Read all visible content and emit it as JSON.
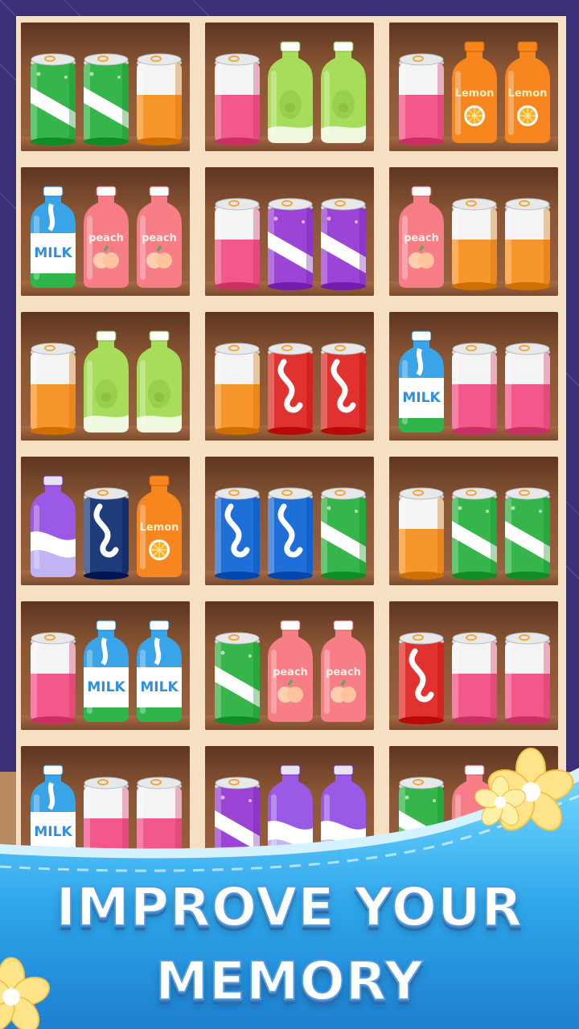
{
  "promo": {
    "headline_line1": "IMPROVE YOUR",
    "headline_line2": "MEMORY"
  },
  "colors": {
    "frame_purple": "#3b2f78",
    "board_beige": "#f6e0c3",
    "shelf_brown": "#7b4a2e",
    "water_blue": "#39b6ef",
    "title_white": "#ffffff"
  },
  "shelves": [
    {
      "items": [
        {
          "kind": "soda-can",
          "color": "#35b54a",
          "label": ""
        },
        {
          "kind": "soda-can",
          "color": "#35b54a",
          "label": ""
        },
        {
          "kind": "plain-can",
          "color": "#f7962a",
          "label": ""
        }
      ]
    },
    {
      "items": [
        {
          "kind": "plain-can",
          "color": "#f2588a",
          "label": ""
        },
        {
          "kind": "avocado-bottle",
          "color": "#a7dd5a",
          "label": ""
        },
        {
          "kind": "avocado-bottle",
          "color": "#a7dd5a",
          "label": ""
        }
      ]
    },
    {
      "items": [
        {
          "kind": "plain-can",
          "color": "#f2588a",
          "label": ""
        },
        {
          "kind": "lemon-bottle",
          "color": "#f7861f",
          "label": "Lemon"
        },
        {
          "kind": "lemon-bottle",
          "color": "#f7861f",
          "label": "Lemon"
        }
      ]
    },
    {
      "items": [
        {
          "kind": "milk-bottle",
          "color": "#3aa4e8",
          "label": "MILK"
        },
        {
          "kind": "peach-bottle",
          "color": "#f77d86",
          "label": "peach"
        },
        {
          "kind": "peach-bottle",
          "color": "#f77d86",
          "label": "peach"
        }
      ]
    },
    {
      "items": [
        {
          "kind": "plain-can",
          "color": "#f2588a",
          "label": ""
        },
        {
          "kind": "soda-can",
          "color": "#9b44d6",
          "label": ""
        },
        {
          "kind": "soda-can",
          "color": "#9b44d6",
          "label": ""
        }
      ]
    },
    {
      "items": [
        {
          "kind": "peach-bottle",
          "color": "#f77d86",
          "label": "peach"
        },
        {
          "kind": "plain-can",
          "color": "#f7962a",
          "label": ""
        },
        {
          "kind": "plain-can",
          "color": "#f7962a",
          "label": ""
        }
      ]
    },
    {
      "items": [
        {
          "kind": "plain-can",
          "color": "#f7962a",
          "label": ""
        },
        {
          "kind": "avocado-bottle",
          "color": "#a7dd5a",
          "label": ""
        },
        {
          "kind": "avocado-bottle",
          "color": "#a7dd5a",
          "label": ""
        }
      ]
    },
    {
      "items": [
        {
          "kind": "plain-can",
          "color": "#f7962a",
          "label": ""
        },
        {
          "kind": "cola-can",
          "color": "#e0322e",
          "label": ""
        },
        {
          "kind": "cola-can",
          "color": "#e0322e",
          "label": ""
        }
      ]
    },
    {
      "items": [
        {
          "kind": "milk-bottle",
          "color": "#3aa4e8",
          "label": "MILK"
        },
        {
          "kind": "plain-can",
          "color": "#f2588a",
          "label": ""
        },
        {
          "kind": "plain-can",
          "color": "#f2588a",
          "label": ""
        }
      ]
    },
    {
      "items": [
        {
          "kind": "grape-bottle",
          "color": "#9b5ae6",
          "label": ""
        },
        {
          "kind": "cola-can",
          "color": "#1f3c7a",
          "label": ""
        },
        {
          "kind": "lemon-bottle",
          "color": "#f7861f",
          "label": "Lemon"
        }
      ]
    },
    {
      "items": [
        {
          "kind": "cola-can",
          "color": "#1f6fd8",
          "label": ""
        },
        {
          "kind": "cola-can",
          "color": "#1f6fd8",
          "label": ""
        },
        {
          "kind": "soda-can",
          "color": "#35b54a",
          "label": ""
        }
      ]
    },
    {
      "items": [
        {
          "kind": "plain-can",
          "color": "#f7962a",
          "label": ""
        },
        {
          "kind": "soda-can",
          "color": "#35b54a",
          "label": ""
        },
        {
          "kind": "soda-can",
          "color": "#35b54a",
          "label": ""
        }
      ]
    },
    {
      "items": [
        {
          "kind": "plain-can",
          "color": "#f2588a",
          "label": ""
        },
        {
          "kind": "milk-bottle",
          "color": "#3aa4e8",
          "label": "MILK"
        },
        {
          "kind": "milk-bottle",
          "color": "#3aa4e8",
          "label": "MILK"
        }
      ]
    },
    {
      "items": [
        {
          "kind": "soda-can",
          "color": "#35b54a",
          "label": ""
        },
        {
          "kind": "peach-bottle",
          "color": "#f77d86",
          "label": "peach"
        },
        {
          "kind": "peach-bottle",
          "color": "#f77d86",
          "label": "peach"
        }
      ]
    },
    {
      "items": [
        {
          "kind": "cola-can",
          "color": "#e0322e",
          "label": ""
        },
        {
          "kind": "plain-can",
          "color": "#f2588a",
          "label": ""
        },
        {
          "kind": "plain-can",
          "color": "#f2588a",
          "label": ""
        }
      ]
    },
    {
      "items": [
        {
          "kind": "milk-bottle",
          "color": "#3aa4e8",
          "label": "MILK"
        },
        {
          "kind": "plain-can",
          "color": "#f2588a",
          "label": ""
        },
        {
          "kind": "plain-can",
          "color": "#f2588a",
          "label": ""
        }
      ]
    },
    {
      "items": [
        {
          "kind": "soda-can",
          "color": "#9b44d6",
          "label": ""
        },
        {
          "kind": "grape-bottle",
          "color": "#9b5ae6",
          "label": ""
        },
        {
          "kind": "grape-bottle",
          "color": "#9b5ae6",
          "label": ""
        }
      ]
    },
    {
      "items": [
        {
          "kind": "soda-can",
          "color": "#35b54a",
          "label": ""
        },
        {
          "kind": "peach-bottle",
          "color": "#f77d86",
          "label": ""
        },
        {
          "kind": "plain-can",
          "color": "#f2588a",
          "label": ""
        }
      ]
    }
  ]
}
